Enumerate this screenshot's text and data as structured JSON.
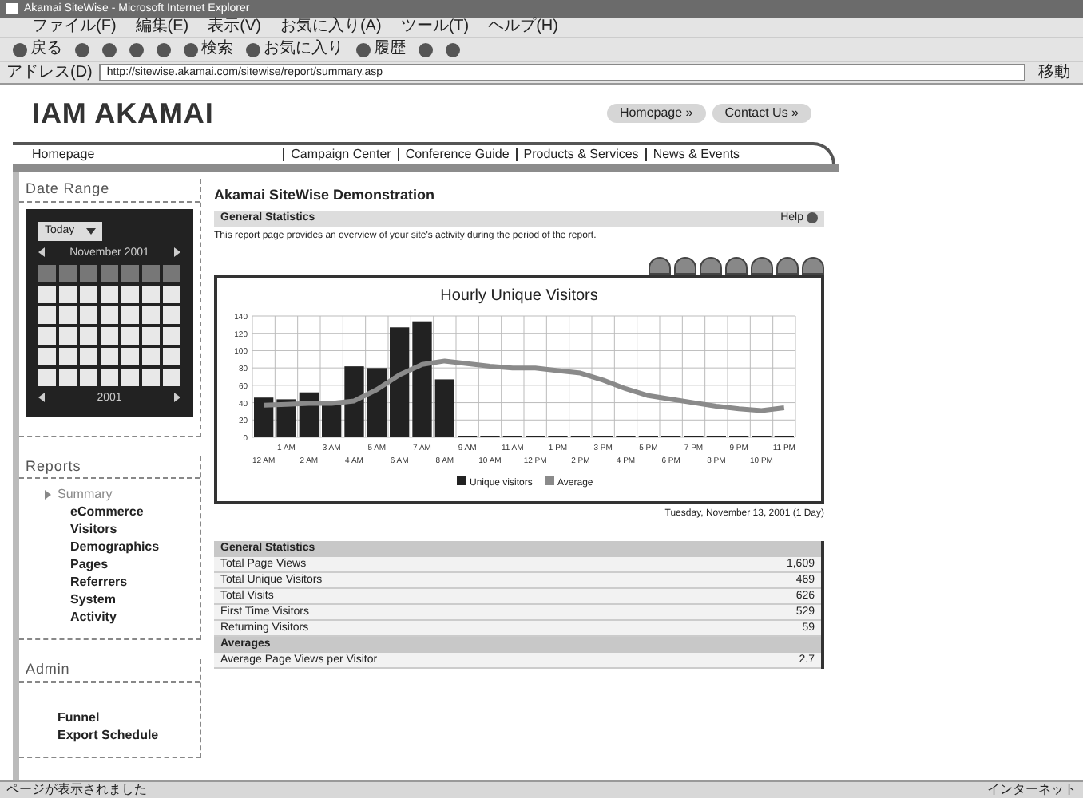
{
  "window": {
    "title": "Akamai SiteWise - Microsoft Internet Explorer"
  },
  "menu": [
    "ファイル(F)",
    "編集(E)",
    "表示(V)",
    "お気に入り(A)",
    "ツール(T)",
    "ヘルプ(H)"
  ],
  "toolbar": {
    "back": "戻る",
    "search": "検索",
    "favorites": "お気に入り",
    "history": "履歴"
  },
  "address_bar": {
    "label": "アドレス(D)",
    "value": "http://sitewise.akamai.com/sitewise/report/summary.asp",
    "go": "移動"
  },
  "header": {
    "logo_left": "IAM",
    "logo_right": "AKAMAI",
    "buttons": [
      "Homepage »",
      "Contact Us »"
    ],
    "home_link": "Homepage",
    "nav": [
      "Campaign Center",
      "Conference Guide",
      "Products & Services",
      "News & Events"
    ]
  },
  "sidebar": {
    "date_range": {
      "title": "Date Range",
      "select": "Today",
      "month": "November 2001",
      "footer": "2001"
    },
    "reports": {
      "title": "Reports",
      "items": [
        {
          "label": "Summary",
          "selected": true
        },
        {
          "label": "eCommerce",
          "selected": false
        },
        {
          "label": "Visitors",
          "selected": false
        },
        {
          "label": "Demographics",
          "selected": false
        },
        {
          "label": "Pages",
          "selected": false
        },
        {
          "label": "Referrers",
          "selected": false
        },
        {
          "label": "System",
          "selected": false
        },
        {
          "label": "Activity",
          "selected": false
        }
      ]
    },
    "admin": {
      "title": "Admin",
      "items": [
        "Funnel",
        "Export Schedule"
      ]
    }
  },
  "content": {
    "title": "Akamai SiteWise Demonstration",
    "section": "General Statistics",
    "help": "Help",
    "description": "This report page provides an overview of your site's activity during the period of the report.",
    "chart": {
      "chart_data": {
        "type": "bar",
        "title": "Hourly Unique Visitors",
        "categories": [
          "12 AM",
          "1 AM",
          "2 AM",
          "3 AM",
          "4 AM",
          "5 AM",
          "6 AM",
          "7 AM",
          "8 AM",
          "9 AM",
          "10 AM",
          "11 AM",
          "12 PM",
          "1 PM",
          "2 PM",
          "3 PM",
          "4 PM",
          "5 PM",
          "6 PM",
          "7 PM",
          "8 PM",
          "9 PM",
          "10 PM",
          "11 PM"
        ],
        "series": [
          {
            "name": "Unique visitors",
            "color": "#222222",
            "values": [
              44,
              42,
              50,
              40,
              80,
              78,
              125,
              132,
              65,
              0,
              0,
              0,
              0,
              0,
              0,
              0,
              0,
              0,
              0,
              0,
              0,
              0,
              0,
              0
            ]
          },
          {
            "name": "Average",
            "type": "line",
            "color": "#8a8a8a",
            "values": [
              37,
              38,
              39,
              39,
              42,
              55,
              72,
              84,
              88,
              85,
              82,
              80,
              80,
              77,
              74,
              66,
              56,
              48,
              44,
              40,
              36,
              33,
              31,
              34
            ]
          }
        ],
        "ylim": [
          0,
          140
        ],
        "grid": true,
        "legend": "bottom",
        "yticks": [
          0,
          20,
          40,
          60,
          80,
          100,
          120,
          140
        ]
      },
      "date": "Tuesday, November 13, 2001 (1 Day)"
    },
    "stats": [
      {
        "label": "General Statistics",
        "kind": "heading"
      },
      {
        "label": "Total Page Views",
        "value": "1,609",
        "kind": "row"
      },
      {
        "label": "Total Unique Visitors",
        "value": "469",
        "kind": "row"
      },
      {
        "label": "Total Visits",
        "value": "626",
        "kind": "row"
      },
      {
        "label": "First Time Visitors",
        "value": "529",
        "kind": "row"
      },
      {
        "label": "Returning Visitors",
        "value": "59",
        "kind": "row"
      },
      {
        "label": "Averages",
        "kind": "heading"
      },
      {
        "label": "Average Page Views per Visitor",
        "value": "2.7",
        "kind": "row"
      }
    ]
  },
  "status_bar": {
    "text": "ページが表示されました",
    "zone": "インターネット"
  }
}
